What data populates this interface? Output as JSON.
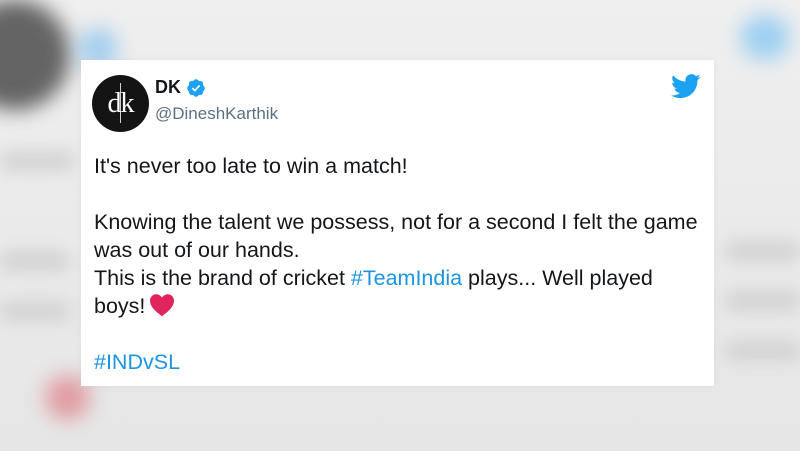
{
  "tweet": {
    "author": {
      "name": "DK",
      "handle": "@DineshKarthik",
      "avatar_initials": "dk",
      "verified": true
    },
    "lines": {
      "line1": "It's never too late to win a match!",
      "line2": "Knowing the talent we possess, not for a second I felt the game was out of our hands.",
      "line3_before": "This is the brand of cricket ",
      "line3_hashtag": "#TeamIndia",
      "line3_after": " plays... Well played boys!",
      "hashtag_final": "#INDvSL"
    },
    "emoji": "red-heart",
    "platform_icon": "twitter-bird-icon"
  },
  "colors": {
    "hashtag": "#1b95e0",
    "twitter_blue": "#1da1f2",
    "heart": "#e0245e",
    "text": "#14171a",
    "handle": "#5b7083"
  }
}
